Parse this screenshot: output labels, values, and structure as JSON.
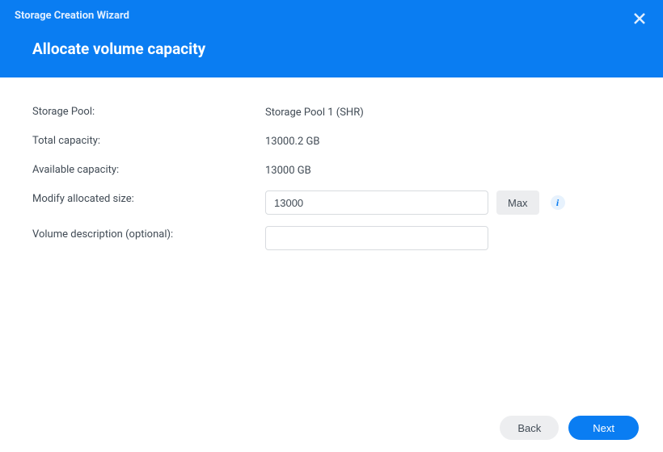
{
  "header": {
    "title": "Storage Creation Wizard",
    "subtitle": "Allocate volume capacity"
  },
  "fields": {
    "storagePool": {
      "label": "Storage Pool:",
      "value": "Storage Pool 1 (SHR)"
    },
    "totalCapacity": {
      "label": "Total capacity:",
      "value": "13000.2 GB"
    },
    "availableCapacity": {
      "label": "Available capacity:",
      "value": "13000 GB"
    },
    "modifyAllocatedSize": {
      "label": "Modify allocated size:",
      "value": "13000",
      "maxButton": "Max"
    },
    "volumeDescription": {
      "label": "Volume description (optional):",
      "value": ""
    }
  },
  "footer": {
    "back": "Back",
    "next": "Next"
  }
}
